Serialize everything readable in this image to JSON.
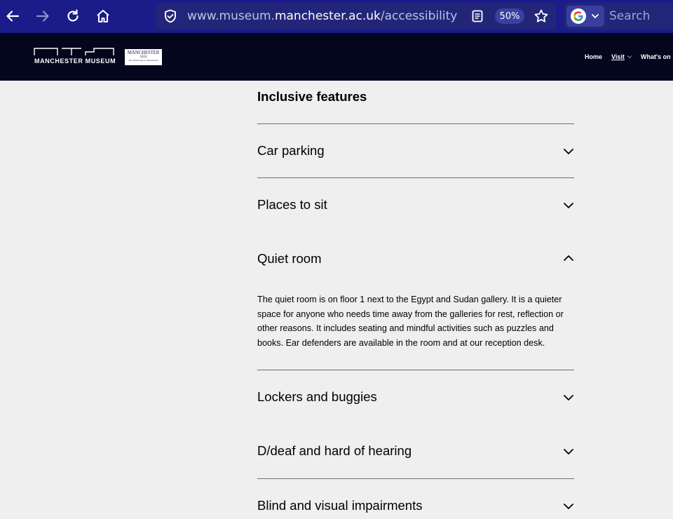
{
  "browser": {
    "url_prefix": "www.museum.",
    "url_domain": "manchester.ac.uk",
    "url_path": "/accessibility",
    "zoom": "50%",
    "search_placeholder": "Search",
    "colors": {
      "chrome": "#1b1c8a",
      "urlbar": "#232678"
    }
  },
  "header": {
    "logo_text": "MANCHESTER MUSEUM",
    "uni_logo": {
      "name": "MANCHESTER",
      "year": "1824",
      "sub": "The University of Manchester"
    },
    "nav": {
      "home": "Home",
      "visit": "Visit",
      "whats_on": "What's on"
    },
    "colors": {
      "background": "#03061d"
    }
  },
  "main": {
    "section_title": "Inclusive features",
    "items": [
      {
        "label": "Car parking",
        "expanded": false
      },
      {
        "label": "Places to sit",
        "expanded": false
      },
      {
        "label": "Quiet room",
        "expanded": true,
        "body": "The quiet room is on floor 1 next to the Egypt and Sudan gallery. It is a quieter space for anyone who needs time away from the galleries for rest, reflection or other reasons. It includes seating and mindful activities such as puzzles and books. Ear defenders are available in the room and at our reception desk."
      },
      {
        "label": "Lockers and buggies",
        "expanded": false
      },
      {
        "label": "D/deaf and hard of hearing",
        "expanded": false
      },
      {
        "label": "Blind and visual impairments",
        "expanded": false
      }
    ]
  }
}
